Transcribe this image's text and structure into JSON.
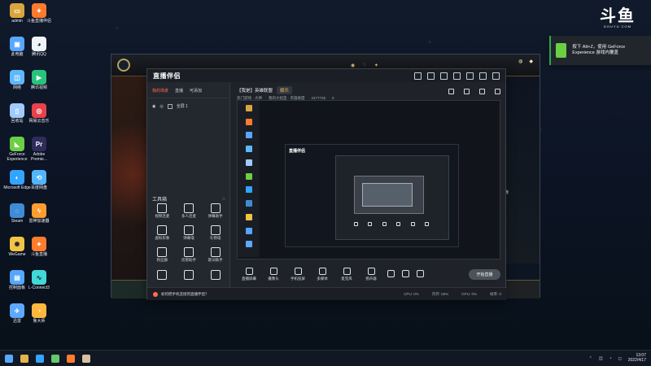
{
  "desktop": {
    "icons": [
      {
        "name": "admin",
        "label": "admin",
        "color": "#d9a63e",
        "glyph": "▭"
      },
      {
        "name": "斗鱼直播伴侣",
        "label": "斗鱼直播伴侣",
        "color": "#ff7b2d",
        "glyph": "✦"
      },
      {
        "name": "此电脑",
        "label": "此电脑",
        "color": "#58a7ff",
        "glyph": "▣"
      },
      {
        "name": "腾讯QQ",
        "label": "腾讯QQ",
        "color": "#f0f3f7",
        "glyph": "◕"
      },
      {
        "name": "网络",
        "label": "网络",
        "color": "#5eb8ff",
        "glyph": "◫"
      },
      {
        "name": "腾讯视频",
        "label": "腾讯视频",
        "color": "#27c37d",
        "glyph": "▶"
      },
      {
        "name": "回收站",
        "label": "回收站",
        "color": "#9fcbff",
        "glyph": "▯"
      },
      {
        "name": "网易云音乐",
        "label": "网易云音乐",
        "color": "#e8424b",
        "glyph": "◎"
      },
      {
        "name": "GeForce Experience",
        "label": "GeForce Experience",
        "color": "#6bcf44",
        "glyph": "◣"
      },
      {
        "name": "Adobe Premie...",
        "label": "Adobe Premie...",
        "color": "#2f2b5c",
        "glyph": "Pr"
      },
      {
        "name": "Microsoft Edge",
        "label": "Microsoft Edge",
        "color": "#33a4ff",
        "glyph": "◐"
      },
      {
        "name": "百度网盘",
        "label": "百度网盘",
        "color": "#54b5ff",
        "glyph": "⟲"
      },
      {
        "name": "Steam",
        "label": "Steam",
        "color": "#3e8cd7",
        "glyph": "◌"
      },
      {
        "name": "雷神加速器",
        "label": "雷神加速器",
        "color": "#ff9d2f",
        "glyph": "ϟ"
      },
      {
        "name": "WeGame",
        "label": "WeGame",
        "color": "#f1c445",
        "glyph": "✺"
      },
      {
        "name": "斗鱼直播",
        "label": "斗鱼直播",
        "color": "#ff7b2d",
        "glyph": "✦"
      },
      {
        "name": "控制面板",
        "label": "控制面板",
        "color": "#55a6ff",
        "glyph": "▤"
      },
      {
        "name": "L-Connect3",
        "label": "L-Connect3",
        "color": "#41d8d7",
        "glyph": "∿"
      },
      {
        "name": "迅雷",
        "label": "迅雷",
        "color": "#5ea8ff",
        "glyph": "✈"
      },
      {
        "name": "鲁大师",
        "label": "鲁大师",
        "color": "#ffb83e",
        "glyph": "◔"
      }
    ]
  },
  "douyu": {
    "logo": "斗鱼",
    "sub": "DOUYU.COM"
  },
  "geforce_toast": {
    "message": "按下 Alt+Z，使用 GeForce Experience 游戏内覆盖"
  },
  "game_window": {
    "chat_text": "了小熊"
  },
  "companion": {
    "app_title": "直播伴侣",
    "left_tabs": [
      "我的场景",
      "直播",
      "可添加"
    ],
    "scene_label": "全屏 1",
    "toolbox_title": "工具箱",
    "tools": [
      "视频连麦",
      "多人连麦",
      "弹幕助手",
      "虚拟形象",
      "弹幕墙",
      "礼物墙",
      "粉丝群",
      "房管助手",
      "歌词助手",
      "",
      "",
      ""
    ],
    "room": {
      "title": "【我是】英雄联盟",
      "badge": "娱乐",
      "meta_1": "热门游戏 · 大神",
      "meta_2": "我的大招是 · 英雄联盟",
      "meta_3": "2477725",
      "meta_4": "0"
    },
    "nested_title": "直播伴侣",
    "bottom_controls": [
      "直播屏幕",
      "摄像头",
      "手机投屏",
      "多媒体",
      "麦克风",
      "扬声器"
    ],
    "start_live": "开始直播",
    "status_text": "如何把手机连接到直播伴侣？",
    "metrics": [
      "CPU: 0%",
      "内存: 56%",
      "GPU: 0%",
      "帧率: 0"
    ]
  },
  "taskbar": {
    "time": "13:07",
    "date": "2022/4/17"
  }
}
